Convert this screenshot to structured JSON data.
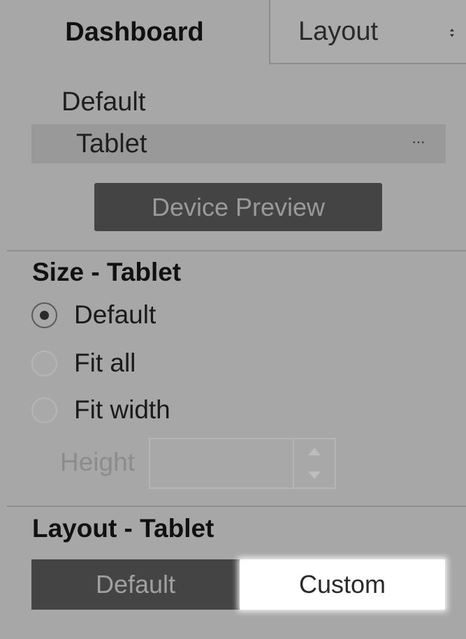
{
  "tabs": {
    "dashboard_label": "Dashboard",
    "layout_label": "Layout"
  },
  "devices": {
    "default_label": "Default",
    "tablet_label": "Tablet",
    "more_label": "···",
    "preview_button": "Device Preview"
  },
  "size": {
    "title": "Size - Tablet",
    "options": [
      {
        "label": "Default",
        "checked": true
      },
      {
        "label": "Fit all",
        "checked": false
      },
      {
        "label": "Fit width",
        "checked": false
      }
    ],
    "height_label": "Height",
    "height_value": ""
  },
  "layout": {
    "title": "Layout - Tablet",
    "segments": [
      {
        "label": "Default",
        "selected": false
      },
      {
        "label": "Custom",
        "selected": true
      }
    ]
  },
  "colors": {
    "background": "#a7a7a7",
    "dark_button": "#444444",
    "selected_segment": "#ffffff"
  }
}
